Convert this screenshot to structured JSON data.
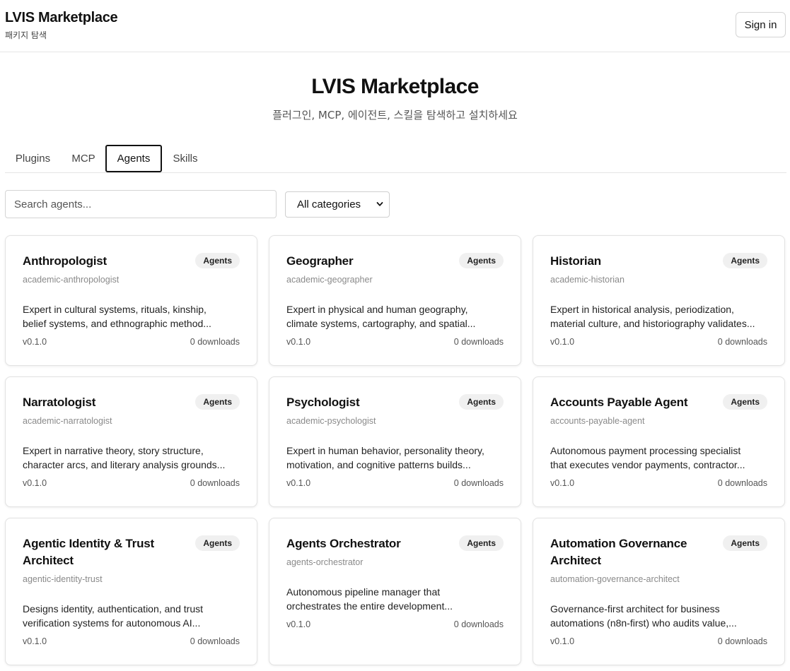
{
  "header": {
    "brand_title": "LVIS Marketplace",
    "brand_subtitle": "패키지 탐색",
    "signin_label": "Sign in"
  },
  "hero": {
    "title": "LVIS Marketplace",
    "subtitle": "플러그인, MCP, 에이전트, 스킬을 탐색하고 설치하세요"
  },
  "tabs": [
    {
      "label": "Plugins",
      "active": false
    },
    {
      "label": "MCP",
      "active": false
    },
    {
      "label": "Agents",
      "active": true
    },
    {
      "label": "Skills",
      "active": false
    }
  ],
  "filters": {
    "search_placeholder": "Search agents...",
    "search_value": "",
    "category_selected": "All categories"
  },
  "cards": [
    {
      "title": "Anthropologist",
      "badge": "Agents",
      "slug": "academic-anthropologist",
      "desc_line1": "Expert in cultural systems, rituals, kinship,",
      "desc_line2": "belief systems, and ethnographic method...",
      "version": "v0.1.0",
      "downloads": "0 downloads"
    },
    {
      "title": "Geographer",
      "badge": "Agents",
      "slug": "academic-geographer",
      "desc_line1": "Expert in physical and human geography,",
      "desc_line2": "climate systems, cartography, and spatial...",
      "version": "v0.1.0",
      "downloads": "0 downloads"
    },
    {
      "title": "Historian",
      "badge": "Agents",
      "slug": "academic-historian",
      "desc_line1": "Expert in historical analysis, periodization,",
      "desc_line2": "material culture, and historiography validates...",
      "version": "v0.1.0",
      "downloads": "0 downloads"
    },
    {
      "title": "Narratologist",
      "badge": "Agents",
      "slug": "academic-narratologist",
      "desc_line1": "Expert in narrative theory, story structure,",
      "desc_line2": "character arcs, and literary analysis grounds...",
      "version": "v0.1.0",
      "downloads": "0 downloads"
    },
    {
      "title": "Psychologist",
      "badge": "Agents",
      "slug": "academic-psychologist",
      "desc_line1": "Expert in human behavior, personality theory,",
      "desc_line2": "motivation, and cognitive patterns builds...",
      "version": "v0.1.0",
      "downloads": "0 downloads"
    },
    {
      "title": "Accounts Payable Agent",
      "badge": "Agents",
      "slug": "accounts-payable-agent",
      "desc_line1": "Autonomous payment processing specialist",
      "desc_line2": "that executes vendor payments, contractor...",
      "version": "v0.1.0",
      "downloads": "0 downloads"
    },
    {
      "title": "Agentic Identity & Trust Architect",
      "badge": "Agents",
      "slug": "agentic-identity-trust",
      "desc_line1": "Designs identity, authentication, and trust",
      "desc_line2": "verification systems for autonomous AI...",
      "version": "v0.1.0",
      "downloads": "0 downloads"
    },
    {
      "title": "Agents Orchestrator",
      "badge": "Agents",
      "slug": "agents-orchestrator",
      "desc_line1": "Autonomous pipeline manager that",
      "desc_line2": "orchestrates the entire development...",
      "version": "v0.1.0",
      "downloads": "0 downloads"
    },
    {
      "title": "Automation Governance Architect",
      "badge": "Agents",
      "slug": "automation-governance-architect",
      "desc_line1": "Governance-first architect for business",
      "desc_line2": "automations (n8n-first) who audits value,...",
      "version": "v0.1.0",
      "downloads": "0 downloads"
    }
  ]
}
